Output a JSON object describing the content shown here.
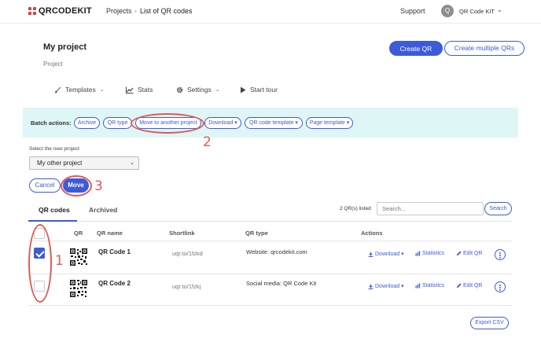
{
  "header": {
    "logo_text": "QRCODEKIT",
    "nav_projects": "Projects",
    "nav_separator": "›",
    "nav_current": "List of QR codes",
    "support": "Support",
    "avatar_letter": "Q",
    "user_name": "QR Code KIT",
    "user_chevron": "⌄"
  },
  "project": {
    "title": "My project",
    "subtitle": "Project",
    "create_qr": "Create QR",
    "create_multiple": "Create multiple QRs"
  },
  "subnav": {
    "templates": "Templates",
    "stats": "Stats",
    "settings": "Settings",
    "start_tour": "Start tour",
    "caret": "⌄"
  },
  "batch": {
    "label": "Batch actions:",
    "archive": "Archive",
    "qr_type": "QR type",
    "move": "Move to another project",
    "download": "Download ▾",
    "qr_template": "QR code template ▾",
    "page_template": "Page template ▾"
  },
  "move_panel": {
    "select_label": "Select the new project",
    "selected_project": "My other project",
    "caret": "⌄",
    "cancel": "Cancel",
    "move": "Move"
  },
  "tabs": {
    "qr_codes": "QR codes",
    "archived": "Archived"
  },
  "listing": {
    "count_text": "2 QR(s) listed",
    "search_placeholder": "Search...",
    "search_button": "Search"
  },
  "table": {
    "headers": {
      "qr": "QR",
      "name": "QR name",
      "shortlink": "Shortlink",
      "type": "QR type",
      "actions": "Actions"
    },
    "rows": [
      {
        "checked": true,
        "name": "QR Code 1",
        "shortlink": "uqr.to/1fzkd",
        "type": "Website: qrcodekit.com",
        "download": "Download ▾",
        "statistics": "Statistics",
        "edit": "Edit QR"
      },
      {
        "checked": false,
        "name": "QR Code 2",
        "shortlink": "uqr.to/1fzkj",
        "type": "Social media: QR Code Kit",
        "download": "Download ▾",
        "statistics": "Statistics",
        "edit": "Edit QR"
      }
    ]
  },
  "export_csv": "Export CSV",
  "annotations": {
    "step1": "1",
    "step2": "2",
    "step3": "3",
    "color": "#e05a55"
  },
  "colors": {
    "accent": "#3d5bd9",
    "batch_bg": "#dff6f6",
    "logo_red": "#e23b3b"
  }
}
